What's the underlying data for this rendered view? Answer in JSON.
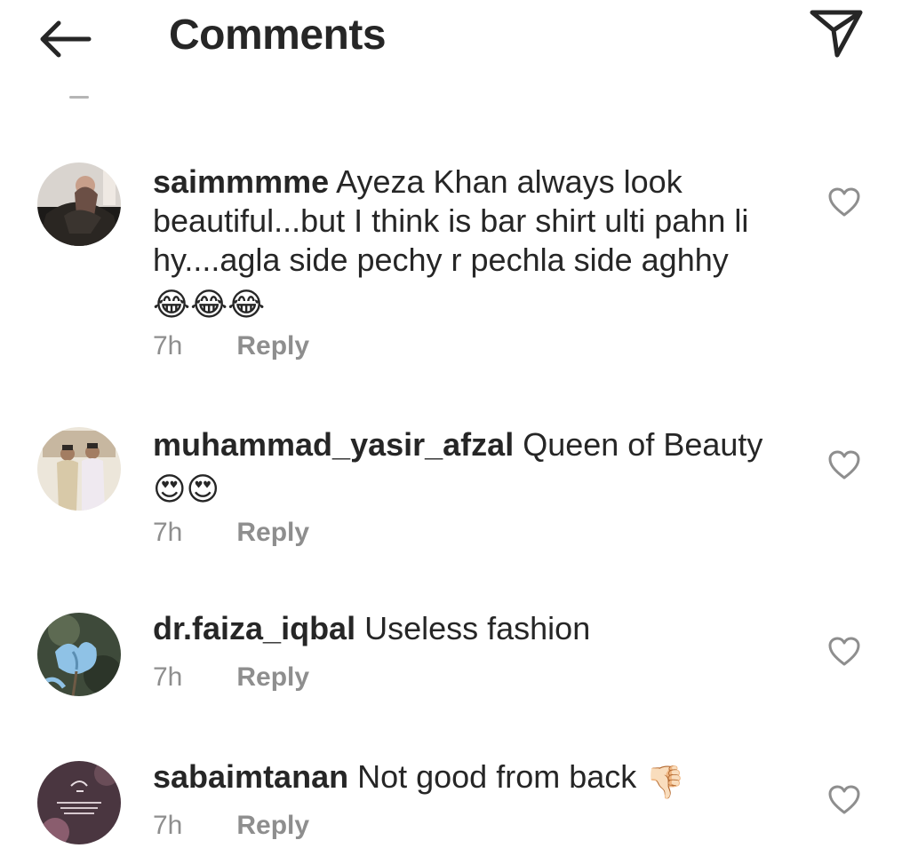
{
  "header": {
    "title": "Comments",
    "back_icon": "arrow-left-icon",
    "share_icon": "paper-plane-icon"
  },
  "comments": [
    {
      "username": "saimmmme",
      "text": "Ayeza Khan always look beautiful...but I think is bar shirt ulti pahn li hy....agla side pechy r pechla side aghhy",
      "emojis": "😂😂😂",
      "time": "7h",
      "reply_label": "Reply"
    },
    {
      "username": "muhammad_yasir_afzal",
      "text": "Queen of Beauty",
      "emojis": "😍😍",
      "time": "7h",
      "reply_label": "Reply"
    },
    {
      "username": "dr.faiza_iqbal",
      "text": "Useless fashion",
      "time": "7h",
      "reply_label": "Reply"
    },
    {
      "username": "sabaimtanan",
      "text": "Not good from back",
      "emojis": "👎🏻",
      "time": "7h",
      "reply_label": "Reply"
    }
  ],
  "colors": {
    "text": "#262626",
    "secondary": "#8e8e8e",
    "background": "#ffffff"
  }
}
